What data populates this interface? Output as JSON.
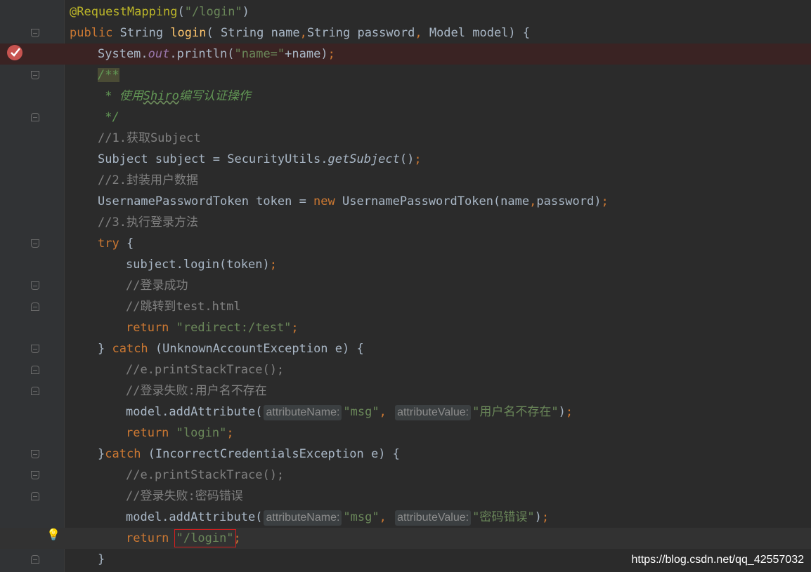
{
  "editor": {
    "lines": [
      {
        "tokens": [
          {
            "t": "ann",
            "v": "@RequestMapping"
          },
          {
            "t": "plain",
            "v": "("
          },
          {
            "t": "str",
            "v": "\"/login\""
          },
          {
            "t": "plain",
            "v": ")"
          }
        ],
        "indent": 0
      },
      {
        "tokens": [
          {
            "t": "kw",
            "v": "public "
          },
          {
            "t": "plain",
            "v": "String "
          },
          {
            "t": "fn",
            "v": "login"
          },
          {
            "t": "plain",
            "v": "( String name"
          },
          {
            "t": "kw",
            "v": ","
          },
          {
            "t": "plain",
            "v": "String password"
          },
          {
            "t": "kw",
            "v": ", "
          },
          {
            "t": "plain",
            "v": "Model model) {"
          }
        ],
        "indent": 0
      },
      {
        "tokens": [
          {
            "t": "plain",
            "v": "System."
          },
          {
            "t": "field",
            "v": "out"
          },
          {
            "t": "plain",
            "v": ".println("
          },
          {
            "t": "str",
            "v": "\"name=\""
          },
          {
            "t": "plain",
            "v": "+name)"
          },
          {
            "t": "kw",
            "v": ";"
          }
        ],
        "indent": 1
      },
      {
        "tokens": [
          {
            "t": "docopen",
            "v": "/**"
          }
        ],
        "indent": 1
      },
      {
        "tokens": [
          {
            "t": "doc",
            "v": " * 使用"
          },
          {
            "t": "docwavy",
            "v": "Shiro"
          },
          {
            "t": "doc",
            "v": "编写认证操作"
          }
        ],
        "indent": 1
      },
      {
        "tokens": [
          {
            "t": "doc",
            "v": " */"
          }
        ],
        "indent": 1
      },
      {
        "tokens": [
          {
            "t": "cmt",
            "v": "//1.获取Subject"
          }
        ],
        "indent": 1
      },
      {
        "tokens": [
          {
            "t": "plain",
            "v": "Subject subject = SecurityUtils."
          },
          {
            "t": "static",
            "v": "getSubject"
          },
          {
            "t": "plain",
            "v": "()"
          },
          {
            "t": "kw",
            "v": ";"
          }
        ],
        "indent": 1
      },
      {
        "tokens": [
          {
            "t": "cmt",
            "v": "//2.封装用户数据"
          }
        ],
        "indent": 1
      },
      {
        "tokens": [
          {
            "t": "plain",
            "v": "UsernamePasswordToken token = "
          },
          {
            "t": "kw",
            "v": "new "
          },
          {
            "t": "plain",
            "v": "UsernamePasswordToken(name"
          },
          {
            "t": "kw",
            "v": ","
          },
          {
            "t": "plain",
            "v": "password)"
          },
          {
            "t": "kw",
            "v": ";"
          }
        ],
        "indent": 1
      },
      {
        "tokens": [
          {
            "t": "cmt",
            "v": "//3.执行登录方法"
          }
        ],
        "indent": 1
      },
      {
        "tokens": [
          {
            "t": "kw",
            "v": "try "
          },
          {
            "t": "plain",
            "v": "{"
          }
        ],
        "indent": 1
      },
      {
        "tokens": [
          {
            "t": "plain",
            "v": "subject.login(token)"
          },
          {
            "t": "kw",
            "v": ";"
          }
        ],
        "indent": 2
      },
      {
        "tokens": [
          {
            "t": "cmt",
            "v": "//登录成功"
          }
        ],
        "indent": 2
      },
      {
        "tokens": [
          {
            "t": "cmt",
            "v": "//跳转到test.html"
          }
        ],
        "indent": 2
      },
      {
        "tokens": [
          {
            "t": "kw",
            "v": "return "
          },
          {
            "t": "str",
            "v": "\"redirect:/test\""
          },
          {
            "t": "kw",
            "v": ";"
          }
        ],
        "indent": 2
      },
      {
        "tokens": [
          {
            "t": "plain",
            "v": "} "
          },
          {
            "t": "kw",
            "v": "catch "
          },
          {
            "t": "plain",
            "v": "(UnknownAccountException e) {"
          }
        ],
        "indent": 1
      },
      {
        "tokens": [
          {
            "t": "cmt",
            "v": "//e.printStackTrace();"
          }
        ],
        "indent": 2
      },
      {
        "tokens": [
          {
            "t": "cmt",
            "v": "//登录失败:用户名不存在"
          }
        ],
        "indent": 2
      },
      {
        "tokens": [
          {
            "t": "plain",
            "v": "model.addAttribute("
          },
          {
            "t": "hint",
            "v": "attributeName:"
          },
          {
            "t": "str",
            "v": "\"msg\""
          },
          {
            "t": "kw",
            "v": ", "
          },
          {
            "t": "hint",
            "v": "attributeValue:"
          },
          {
            "t": "str",
            "v": "\"用户名不存在\""
          },
          {
            "t": "plain",
            "v": ")"
          },
          {
            "t": "kw",
            "v": ";"
          }
        ],
        "indent": 2
      },
      {
        "tokens": [
          {
            "t": "kw",
            "v": "return "
          },
          {
            "t": "str",
            "v": "\"login\""
          },
          {
            "t": "kw",
            "v": ";"
          }
        ],
        "indent": 2
      },
      {
        "tokens": [
          {
            "t": "plain",
            "v": "}"
          },
          {
            "t": "kw",
            "v": "catch "
          },
          {
            "t": "plain",
            "v": "(IncorrectCredentialsException e) {"
          }
        ],
        "indent": 1
      },
      {
        "tokens": [
          {
            "t": "cmt",
            "v": "//e.printStackTrace();"
          }
        ],
        "indent": 2
      },
      {
        "tokens": [
          {
            "t": "cmt",
            "v": "//登录失败:密码错误"
          }
        ],
        "indent": 2
      },
      {
        "tokens": [
          {
            "t": "plain",
            "v": "model.addAttribute("
          },
          {
            "t": "hint",
            "v": "attributeName:"
          },
          {
            "t": "str",
            "v": "\"msg\""
          },
          {
            "t": "kw",
            "v": ", "
          },
          {
            "t": "hint",
            "v": "attributeValue:"
          },
          {
            "t": "str",
            "v": "\"密码错误\""
          },
          {
            "t": "plain",
            "v": ")"
          },
          {
            "t": "kw",
            "v": ";"
          }
        ],
        "indent": 2
      },
      {
        "tokens": [
          {
            "t": "kw",
            "v": "return "
          },
          {
            "t": "strsel",
            "v": "\"/login\""
          },
          {
            "t": "kw",
            "v": ";"
          }
        ],
        "indent": 2
      },
      {
        "tokens": [
          {
            "t": "plain",
            "v": "}"
          }
        ],
        "indent": 1
      }
    ]
  },
  "watermark": "https://blog.csdn.net/qq_42557032",
  "icons": {
    "breakpoint": "breakpoint-check-icon",
    "bulb": "lightbulb-icon",
    "fold": "fold-marker-icon"
  },
  "colors": {
    "keyword": "#cc7832",
    "string": "#6a8759",
    "comment": "#808080",
    "annotation": "#bbb529",
    "method": "#ffc66d"
  }
}
